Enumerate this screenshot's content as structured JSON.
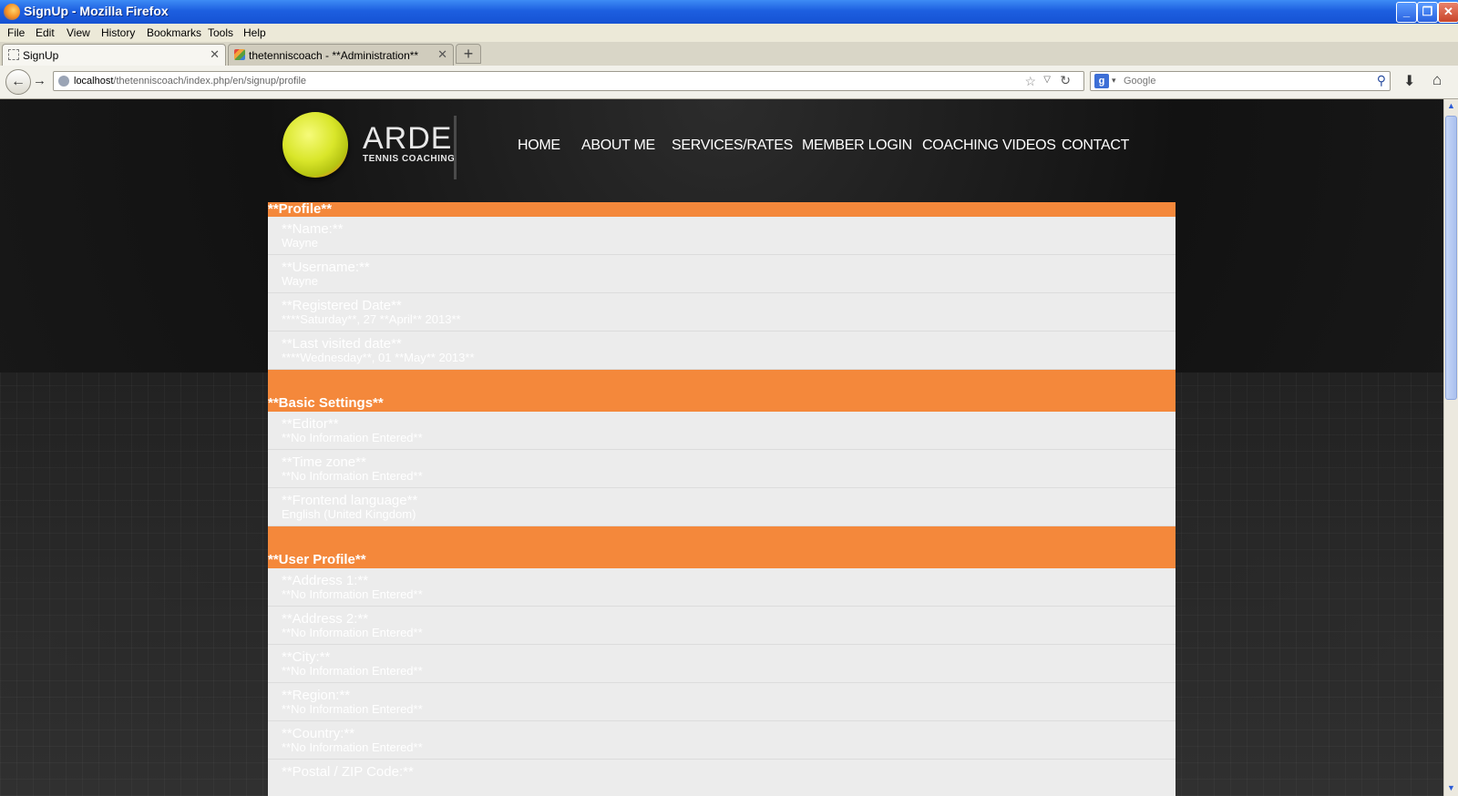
{
  "window": {
    "title": "SignUp - Mozilla Firefox"
  },
  "menu": [
    "File",
    "Edit",
    "View",
    "History",
    "Bookmarks",
    "Tools",
    "Help"
  ],
  "tabs": [
    {
      "label": "SignUp"
    },
    {
      "label": "thetenniscoach - **Administration**"
    }
  ],
  "address": {
    "host": "localhost",
    "path": "/thetenniscoach/index.php/en/signup/profile"
  },
  "search": {
    "placeholder": "Google",
    "engine_letter": "g"
  },
  "brand": {
    "name": "ARDE",
    "tagline": "TENNIS COACHING"
  },
  "nav": [
    "HOME",
    "ABOUT ME",
    "SERVICES/RATES",
    "MEMBER LOGIN",
    "COACHING VIDEOS",
    "CONTACT"
  ],
  "profile": {
    "title": "**Profile**",
    "fields": [
      {
        "label": "**Name:**",
        "value": "Wayne"
      },
      {
        "label": "**Username:**",
        "value": "Wayne"
      },
      {
        "label": "**Registered Date**",
        "value": "****Saturday**, 27 **April** 2013**"
      },
      {
        "label": "**Last visited date**",
        "value": "****Wednesday**, 01 **May** 2013**"
      }
    ]
  },
  "basic": {
    "title": "**Basic Settings**",
    "fields": [
      {
        "label": "**Editor**",
        "value": "**No Information Entered**"
      },
      {
        "label": "**Time zone**",
        "value": "**No Information Entered**"
      },
      {
        "label": "**Frontend language**",
        "value": "English (United Kingdom)"
      }
    ]
  },
  "user_profile": {
    "title": "**User Profile**",
    "fields": [
      {
        "label": "**Address 1:**",
        "value": "**No Information Entered**"
      },
      {
        "label": "**Address 2:**",
        "value": "**No Information Entered**"
      },
      {
        "label": "**City:**",
        "value": "**No Information Entered**"
      },
      {
        "label": "**Region:**",
        "value": "**No Information Entered**"
      },
      {
        "label": "**Country:**",
        "value": "**No Information Entered**"
      },
      {
        "label": "**Postal / ZIP Code:**",
        "value": ""
      }
    ]
  },
  "colors": {
    "accent": "#f4883b",
    "field_bg": "#ececec",
    "page_bg": "#1a1a1a"
  }
}
